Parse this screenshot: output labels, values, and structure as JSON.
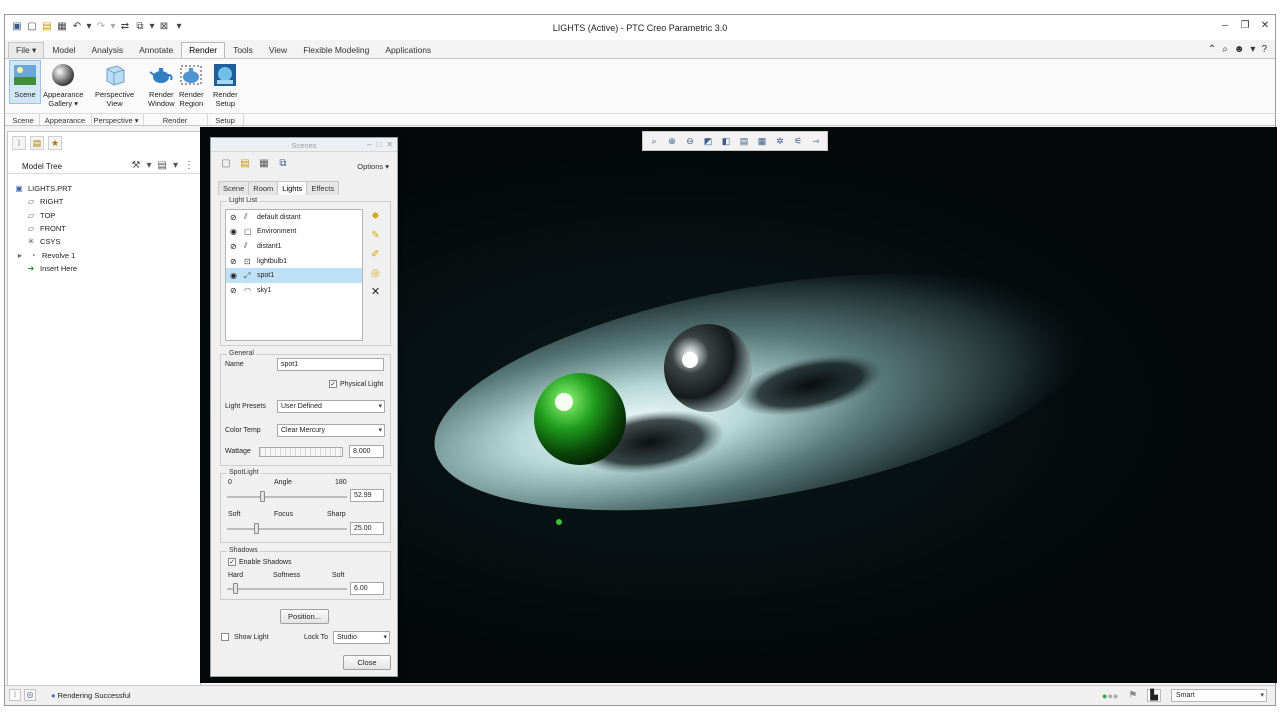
{
  "window": {
    "title": "LIGHTS (Active) - PTC Creo Parametric 3.0"
  },
  "ribbon": {
    "tabs": [
      "File ▾",
      "Model",
      "Analysis",
      "Annotate",
      "Render",
      "Tools",
      "View",
      "Flexible Modeling",
      "Applications"
    ],
    "active_tab": "Render",
    "buttons": {
      "scene": "Scene",
      "appearance_gallery_1": "Appearance",
      "appearance_gallery_2": "Gallery ▾",
      "perspective_view_1": "Perspective",
      "perspective_view_2": "View",
      "render_window_1": "Render",
      "render_window_2": "Window",
      "render_region_1": "Render",
      "render_region_2": "Region",
      "render_setup_1": "Render",
      "render_setup_2": "Setup"
    },
    "groups": {
      "scene": "Scene",
      "appearance": "Appearance",
      "perspective": "Perspective ▾",
      "render": "Render",
      "setup": "Setup"
    }
  },
  "model_tree": {
    "title": "Model Tree",
    "items": [
      {
        "label": "LIGHTS.PRT",
        "icon": "part-icon"
      },
      {
        "label": "RIGHT",
        "icon": "datum-plane-icon"
      },
      {
        "label": "TOP",
        "icon": "datum-plane-icon"
      },
      {
        "label": "FRONT",
        "icon": "datum-plane-icon"
      },
      {
        "label": "CSYS",
        "icon": "csys-icon"
      },
      {
        "label": "Revolve 1",
        "icon": "revolve-icon"
      },
      {
        "label": "Insert Here",
        "icon": "insert-here-arrow-icon"
      }
    ]
  },
  "scenes_dialog": {
    "title": "Scenes",
    "options_label": "Options ▾",
    "tabs": [
      "Scene",
      "Room",
      "Lights",
      "Effects"
    ],
    "active_tab": "Lights",
    "light_list": {
      "label": "Light List",
      "items": [
        {
          "label": "default distant",
          "visible": false
        },
        {
          "label": "Environment",
          "visible": true
        },
        {
          "label": "distant1",
          "visible": false
        },
        {
          "label": "lightbulb1",
          "visible": false
        },
        {
          "label": "spot1",
          "visible": true,
          "selected": true
        },
        {
          "label": "sky1",
          "visible": false
        }
      ]
    },
    "general": {
      "label": "General",
      "name_label": "Name",
      "name_value": "spot1",
      "physical_light_label": "Physical Light",
      "physical_light_checked": true,
      "light_presets_label": "Light Presets",
      "light_presets_value": "User Defined",
      "color_temp_label": "Color Temp",
      "color_temp_value": "Clear Mercury",
      "wattage_label": "Wattage",
      "wattage_value": "8.000"
    },
    "spotlight": {
      "label": "SpotLight",
      "angle_min": "0",
      "angle_label": "Angle",
      "angle_max": "180",
      "angle_value": "52.99",
      "focus_soft": "Soft",
      "focus_label": "Focus",
      "focus_sharp": "Sharp",
      "focus_value": "25.00"
    },
    "shadows": {
      "label": "Shadows",
      "enable_label": "Enable Shadows",
      "enable_checked": true,
      "softness_hard": "Hard",
      "softness_label": "Softness",
      "softness_soft": "Soft",
      "softness_value": "6.00"
    },
    "position_button": "Position...",
    "show_light_label": "Show Light",
    "lock_to_label": "Lock To",
    "lock_to_value": "Studio",
    "close_button": "Close"
  },
  "status": {
    "message": "Rendering Successful",
    "filter_value": "Smart"
  }
}
